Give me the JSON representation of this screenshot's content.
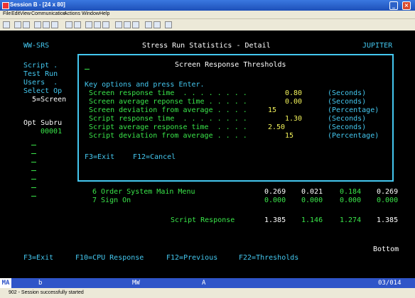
{
  "window": {
    "title": "Session B - [24 x 80]"
  },
  "menu": [
    "File",
    "Edit",
    "View",
    "Communication",
    "Actions",
    "Window",
    "Help"
  ],
  "screen": {
    "system_id": "WW-SRS",
    "title": "Stress Run Statistics - Detail",
    "host": "JUPITER",
    "left_labels": [
      "Script .",
      "Test Run",
      "Users  .",
      "Select Op",
      "  5=Screen"
    ],
    "opt_header": "Opt Subru",
    "opt_value": "00001",
    "rows": [
      {
        "label": "6 Order System Main Menu",
        "v1": "0.269",
        "v2": "0.021",
        "v3": "0.184",
        "v4": "0.269"
      },
      {
        "label": "7 Sign On",
        "v1": "0.000",
        "v2": "0.000",
        "v3": "0.000",
        "v4": "0.000"
      }
    ],
    "total": {
      "label": "Script Response",
      "v1": "1.385",
      "v2": "1.146",
      "v3": "1.274",
      "v4": "1.385"
    },
    "bottom_marker": "Bottom",
    "fkeys": [
      "F3=Exit",
      "F10=CPU Response",
      "F12=Previous",
      "F22=Thresholds"
    ]
  },
  "dialog": {
    "title": "Screen Response Thresholds",
    "instruction": "Key options and press Enter.",
    "fields": [
      {
        "label": "Screen response time  . . . . . . . .",
        "value": "0.80",
        "unit": "(Seconds)"
      },
      {
        "label": "Screen average reponse time . . . . .",
        "value": "0.00",
        "unit": "(Seconds)"
      },
      {
        "label": "Screen deviation from average . . . .",
        "value": "15",
        "unit": "(Percentage)"
      },
      {
        "label": "Script response time  . . . . . . . .",
        "value": "1.30",
        "unit": "(Seconds)"
      },
      {
        "label": "Script average response time  . . . .",
        "value": "2.50",
        "unit": "(Seconds)"
      },
      {
        "label": "Script deviation from average . . . .",
        "value": "15",
        "unit": "(Percentage)"
      }
    ],
    "exit_key": "F3=Exit",
    "cancel_key": "F12=Cancel"
  },
  "statusbar": {
    "ma": "MA",
    "session": "b",
    "mw": "MW",
    "a": "A",
    "cursor": "03/014"
  },
  "footer": {
    "text": "902 - Session successfully started"
  }
}
